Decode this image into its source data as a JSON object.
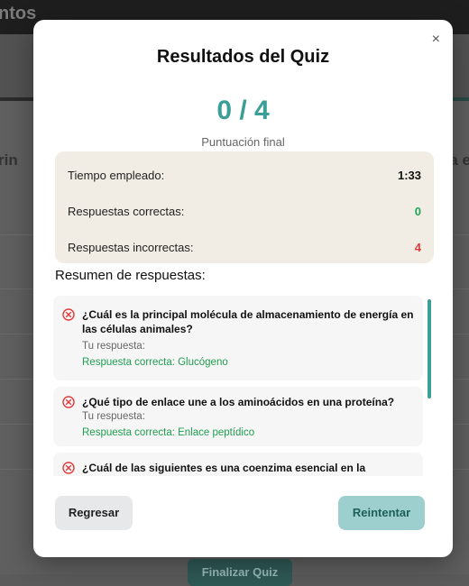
{
  "background": {
    "header_title": "ntos",
    "side_left": "rin",
    "side_right": "a e",
    "finish_button": "Finalizar Quiz"
  },
  "modal": {
    "title": "Resultados del Quiz",
    "close_symbol": "×",
    "score": "0 / 4",
    "score_label": "Puntuación final",
    "stats": [
      {
        "label": "Tiempo empleado:",
        "value": "1:33"
      },
      {
        "label": "Respuestas correctas:",
        "value": "0"
      },
      {
        "label": "Respuestas incorrectas:",
        "value": "4"
      }
    ],
    "summary_title": "Resumen de respuestas:",
    "answers": [
      {
        "question": "¿Cuál es la principal molécula de almacenamiento de energía en las células animales?",
        "your_answer_label": "Tu respuesta:",
        "correct_answer": "Respuesta correcta: Glucógeno"
      },
      {
        "question": "¿Qué tipo de enlace une a los aminoácidos en una proteína?",
        "your_answer_label": "Tu respuesta:",
        "correct_answer": "Respuesta correcta: Enlace peptídico"
      },
      {
        "question": "¿Cuál de las siguientes es una coenzima esencial en la",
        "your_answer_label": "",
        "correct_answer": ""
      }
    ],
    "buttons": {
      "back": "Regresar",
      "retry": "Reintentar"
    }
  },
  "colors": {
    "accent": "#3b9e97",
    "correct": "#22a55a",
    "incorrect": "#e03a3a"
  }
}
